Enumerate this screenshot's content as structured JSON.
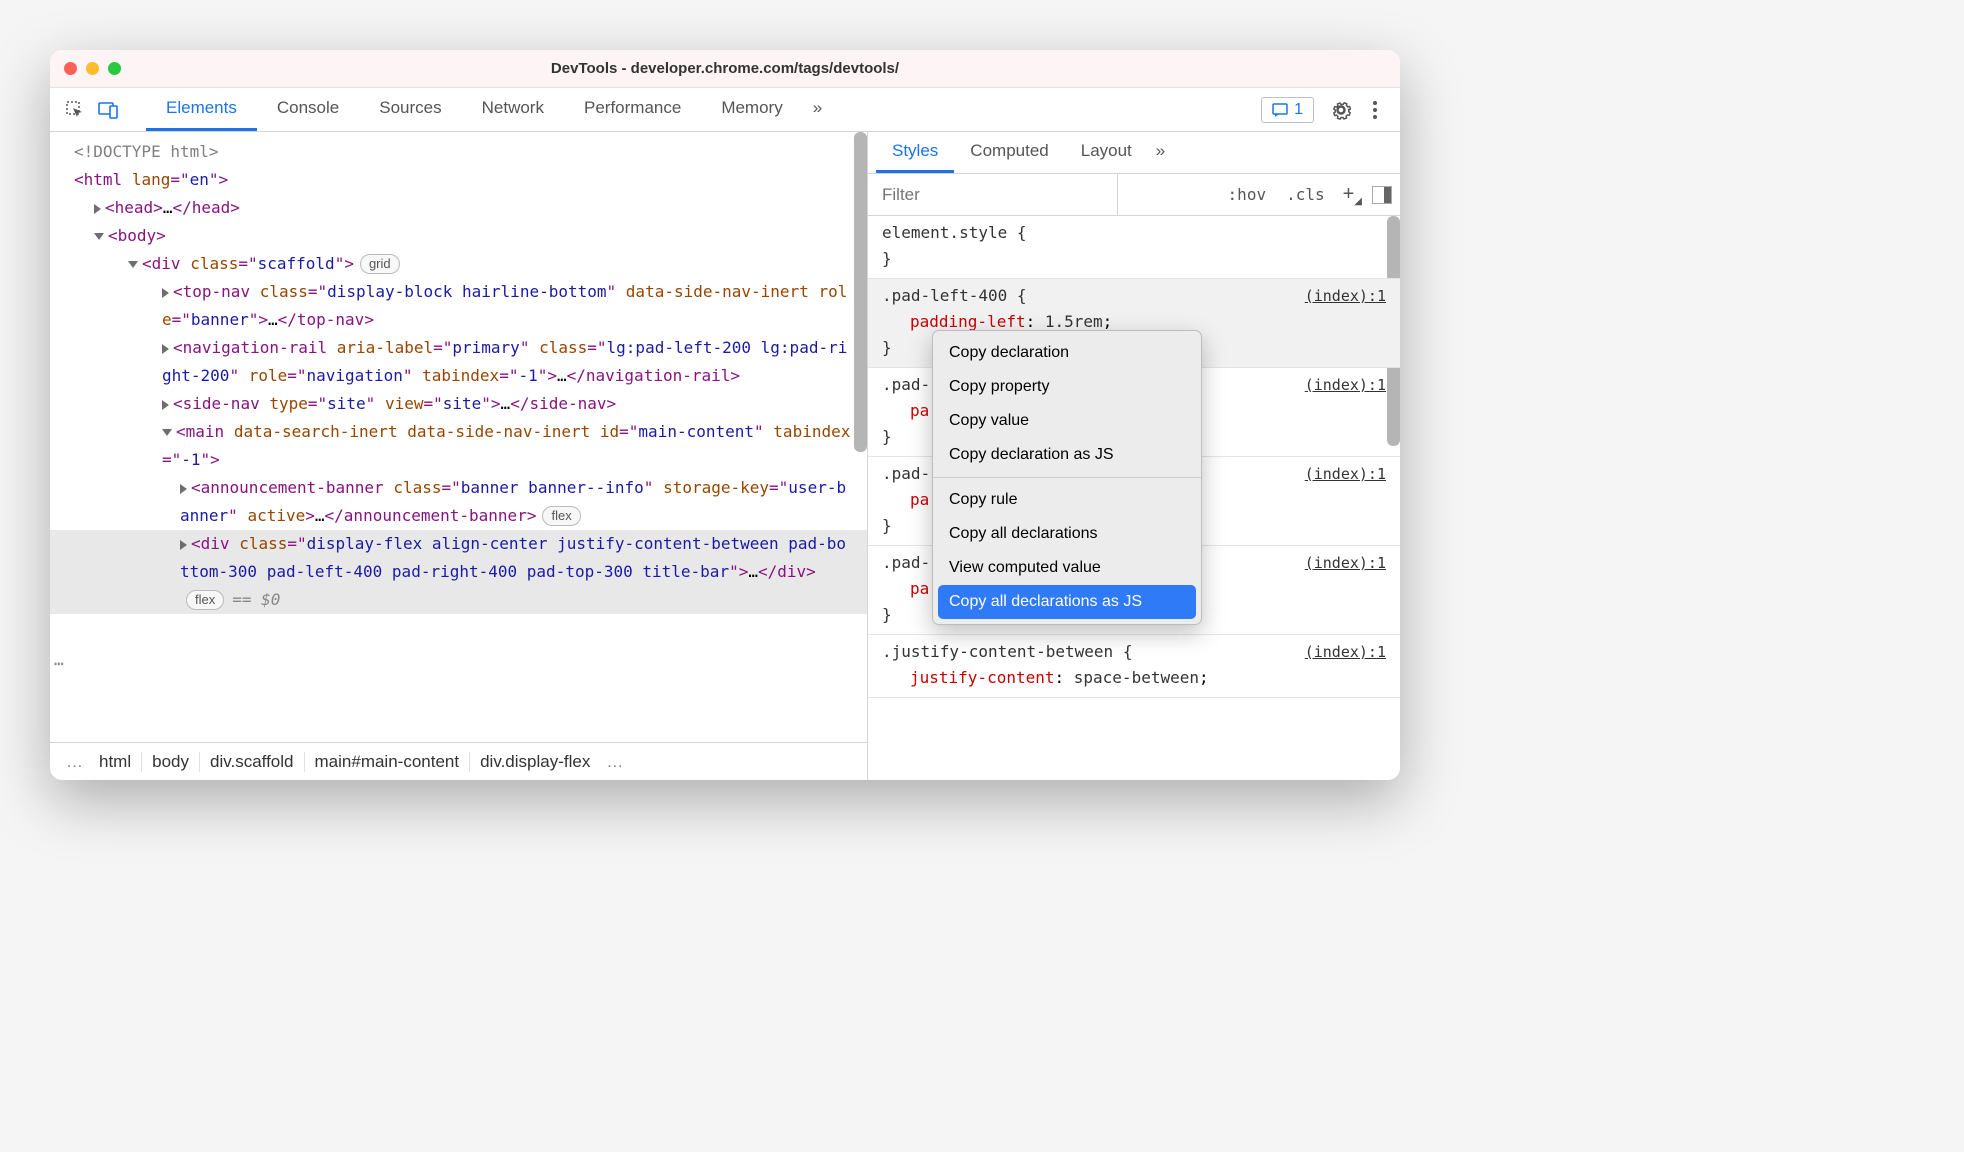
{
  "window": {
    "title": "DevTools - developer.chrome.com/tags/devtools/"
  },
  "toolbar": {
    "tabs": [
      "Elements",
      "Console",
      "Sources",
      "Network",
      "Performance",
      "Memory"
    ],
    "overflow": "»",
    "issue_count": "1"
  },
  "tree": {
    "doctype": "<!DOCTYPE html>",
    "html_open": "html",
    "html_attr_name": "lang",
    "html_attr_val": "en",
    "head": "head",
    "body": "body",
    "div1_tag": "div",
    "div1_class": "scaffold",
    "div1_badge": "grid",
    "topnav_tag": "top-nav",
    "topnav_class": "display-block hairline-bottom",
    "topnav_attr2": "data-side-nav-inert",
    "topnav_role": "banner",
    "navrail_tag": "navigation-rail",
    "navrail_aria": "primary",
    "navrail_class": "lg:pad-left-200 lg:pad-right-200",
    "navrail_role": "navigation",
    "navrail_tab": "-1",
    "sidenav_tag": "side-nav",
    "sidenav_type": "site",
    "sidenav_view": "site",
    "main_tag": "main",
    "main_a1": "data-search-inert",
    "main_a2": "data-side-nav-inert",
    "main_id": "main-content",
    "main_tab": "-1",
    "ann_tag": "announcement-banner",
    "ann_class": "banner banner--info",
    "ann_key_name": "storage-key",
    "ann_key_val": "user-banner",
    "ann_active": "active",
    "ann_badge": "flex",
    "div2_tag": "div",
    "div2_class": "display-flex align-center justify-content-between pad-bottom-300 pad-left-400 pad-right-400 pad-top-300 title-bar",
    "div2_badge": "flex",
    "eq0": "== $0"
  },
  "crumbs": {
    "c1": "html",
    "c2": "body",
    "c3a": "div",
    "c3b": ".scaffold",
    "c4a": "main",
    "c4b": "#main-content",
    "c5a": "div",
    "c5b": ".display-flex"
  },
  "styles": {
    "tabs": [
      "Styles",
      "Computed",
      "Layout"
    ],
    "overflow": "»",
    "filter_placeholder": "Filter",
    "hov": ":hov",
    "cls": ".cls",
    "element_style": "element.style",
    "rules": [
      {
        "selector": ".pad-left-400",
        "link": "(index):1",
        "prop": "padding-left",
        "val": "1.5rem"
      },
      {
        "selector": ".pad-",
        "link": "(index):1",
        "prop": "pa",
        "val": ""
      },
      {
        "selector": ".pad-",
        "link": "(index):1",
        "prop": "pa",
        "val": ""
      },
      {
        "selector": ".pad-",
        "link": "(index):1",
        "prop": "pa",
        "val": ""
      },
      {
        "selector": ".justify-content-between",
        "link": "(index):1",
        "prop": "justify-content",
        "val": "space-between"
      }
    ]
  },
  "context_menu": {
    "items": [
      "Copy declaration",
      "Copy property",
      "Copy value",
      "Copy declaration as JS",
      "-",
      "Copy rule",
      "Copy all declarations",
      "View computed value",
      "Copy all declarations as JS"
    ],
    "highlight_index": 8
  }
}
